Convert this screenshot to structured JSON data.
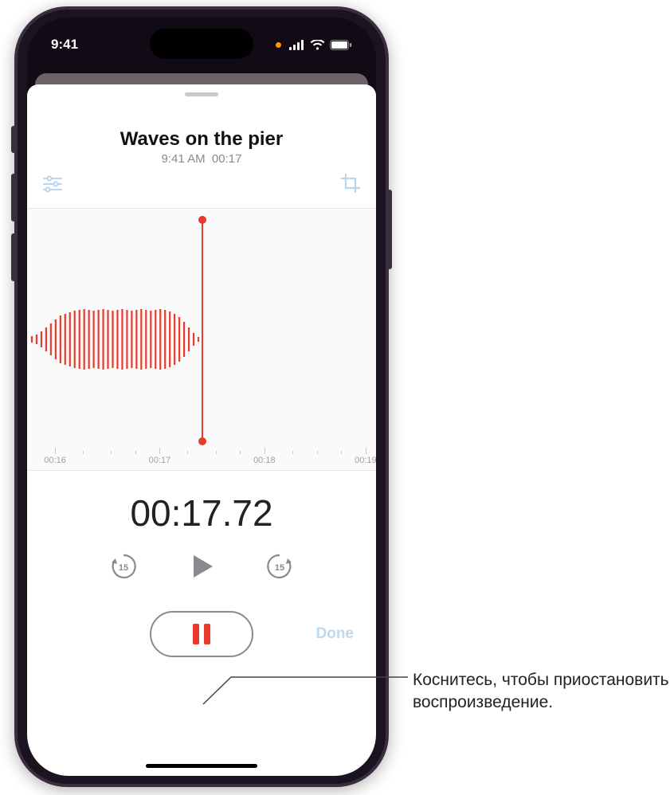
{
  "status": {
    "time": "9:41"
  },
  "recording": {
    "title": "Waves on the pier",
    "timestamp": "9:41 AM",
    "duration": "00:17"
  },
  "timeline": {
    "ticks": [
      "00:16",
      "00:17",
      "00:18",
      "00:19"
    ]
  },
  "elapsed": "00:17.72",
  "buttons": {
    "done": "Done"
  },
  "callout": "Коснитесь, чтобы приостановить воспроизведение."
}
